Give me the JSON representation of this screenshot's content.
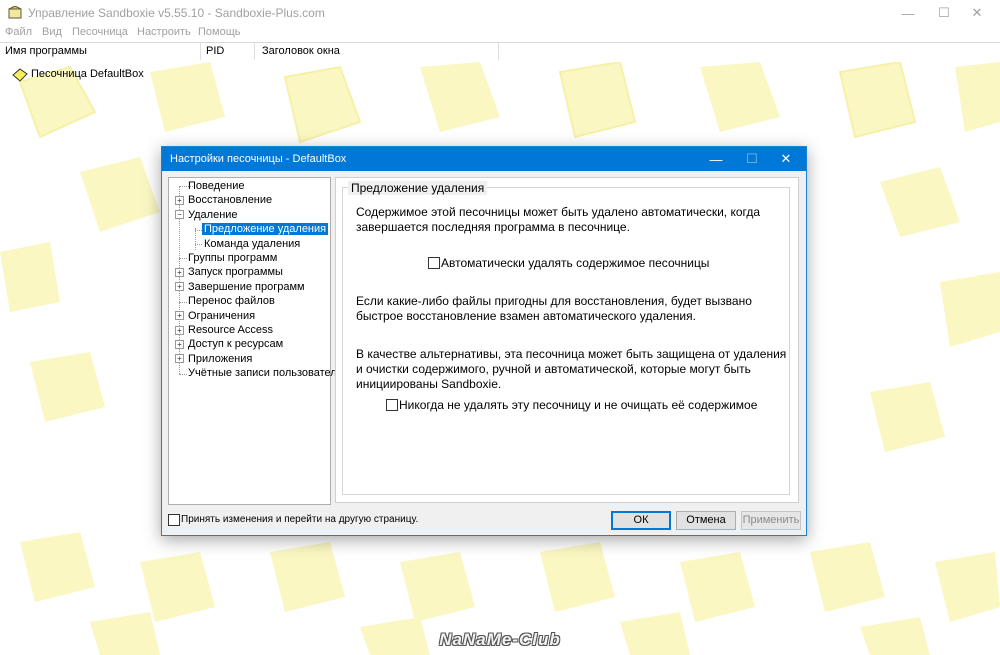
{
  "window": {
    "title": "Управление Sandboxie v5.55.10 - Sandboxie-Plus.com",
    "controls": {
      "minimize": "—",
      "maximize": "☐",
      "close": "✕"
    }
  },
  "menu": [
    "Файл",
    "Вид",
    "Песочница",
    "Настроить",
    "Помощь"
  ],
  "columns": {
    "program": "Имя программы",
    "pid": "PID",
    "window_title": "Заголовок окна"
  },
  "sandboxes": [
    {
      "label": "Песочница DefaultBox"
    }
  ],
  "watermark": "NaNaMe-Club",
  "dialog": {
    "title": "Настройки песочницы - DefaultBox",
    "controls": {
      "minimize": "—",
      "maximize": "☐",
      "close": "✕"
    },
    "tree": [
      {
        "label": "Поведение",
        "expander": ""
      },
      {
        "label": "Восстановление",
        "expander": "+"
      },
      {
        "label": "Удаление",
        "expander": "−"
      },
      {
        "label": "Предложение удаления",
        "child": true,
        "selected": true
      },
      {
        "label": "Команда удаления",
        "child": true
      },
      {
        "label": "Группы программ",
        "expander": ""
      },
      {
        "label": "Запуск программы",
        "expander": "+"
      },
      {
        "label": "Завершение программ",
        "expander": "+"
      },
      {
        "label": "Перенос файлов",
        "expander": ""
      },
      {
        "label": "Ограничения",
        "expander": "+"
      },
      {
        "label": "Resource Access",
        "expander": "+"
      },
      {
        "label": "Доступ к ресурсам",
        "expander": "+"
      },
      {
        "label": "Приложения",
        "expander": "+"
      },
      {
        "label": "Учётные записи пользователей",
        "expander": ""
      }
    ],
    "page": {
      "group_title": "Предложение удаления",
      "para1": "Содержимое этой песочницы может быть удалено автоматически, когда завершается последняя программа в песочнице.",
      "auto_delete_label": "Автоматически удалять содержимое песочницы",
      "para2": "Если какие-либо файлы пригодны для восстановления, будет вызвано быстрое восстановление взамен автоматического удаления.",
      "para3": "В качестве альтернативы, эта песочница может быть защищена от удаления и очистки содержимого, ручной и автоматической, которые могут быть инициированы Sandboxie.",
      "never_delete_label": "Никогда не удалять эту песочницу и не очищать её содержимое"
    },
    "footer": {
      "apply_and_next_label": "Принять изменения и перейти на другую страницу.",
      "ok": "ОК",
      "cancel": "Отмена",
      "apply": "Применить"
    }
  }
}
